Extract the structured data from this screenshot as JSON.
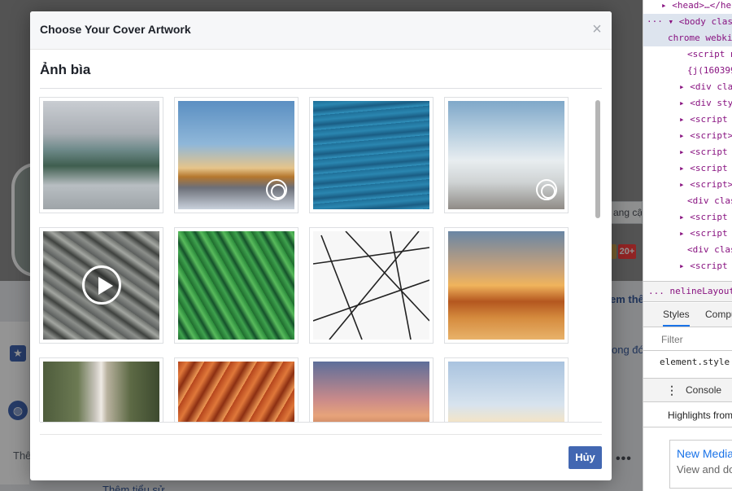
{
  "background_page": {
    "button_partial": "ang cậ",
    "badge": "20+",
    "link_partial_1": "em thê",
    "link_partial_2": "ong đó",
    "text_partial": "Thê",
    "link_bottom": "Thêm tiểu sử",
    "more_dots": "•••"
  },
  "devtools": {
    "lines": [
      {
        "text": "▸ <head>…</he",
        "indent": 22
      },
      {
        "text": "··· ▾ <body clas",
        "indent": 4
      },
      {
        "text": "chrome webki",
        "indent": 30
      },
      {
        "text": "<script n",
        "indent": 54
      },
      {
        "text": "{j(160399",
        "indent": 54
      },
      {
        "text": "▸ <div clas",
        "indent": 44
      },
      {
        "text": "▸ <div styl",
        "indent": 44
      },
      {
        "text": "▸ <script t",
        "indent": 44
      },
      {
        "text": "▸ <script>…",
        "indent": 44
      },
      {
        "text": "▸ <script n",
        "indent": 44
      },
      {
        "text": "▸ <script n",
        "indent": 44
      },
      {
        "text": "▸ <script>…",
        "indent": 44
      },
      {
        "text": "<div clas",
        "indent": 54
      },
      {
        "text": "▸ <script n",
        "indent": 44
      },
      {
        "text": "▸ <script n",
        "indent": 44
      },
      {
        "text": "<div clas",
        "indent": 54
      },
      {
        "text": "▸ <script n",
        "indent": 44
      }
    ],
    "breadcrumb": "... nelineLayout",
    "tabs": [
      "Styles",
      "Compu"
    ],
    "filter_placeholder": "Filter",
    "element_style": "element.style",
    "console_tab": "Console",
    "highlights": "Highlights from",
    "card_title": "New Media",
    "card_subtitle": "View and do"
  },
  "modal": {
    "title": "Choose Your Cover Artwork",
    "close_glyph": "×",
    "section_title": "Ảnh bìa",
    "cancel_label": "Hủy",
    "accent_color": "#4267b2",
    "artworks": [
      {
        "name": "mountain-lake",
        "style": "img-mountains",
        "overlay": ""
      },
      {
        "name": "sunset-peak-360",
        "style": "img-sunset",
        "overlay": "pano"
      },
      {
        "name": "ocean-waves",
        "style": "img-ocean",
        "overlay": ""
      },
      {
        "name": "cloud-sky-360",
        "style": "img-clouds",
        "overlay": "pano"
      },
      {
        "name": "rocks-video",
        "style": "img-rocks",
        "overlay": "play"
      },
      {
        "name": "fern-leaves",
        "style": "img-fern",
        "overlay": ""
      },
      {
        "name": "abstract-lines",
        "style": "img-lines",
        "overlay": "lines"
      },
      {
        "name": "desert-sunset",
        "style": "img-desert",
        "overlay": ""
      },
      {
        "name": "waterfall",
        "style": "img-waterfall",
        "overlay": ""
      },
      {
        "name": "red-canyon",
        "style": "img-canyon",
        "overlay": ""
      },
      {
        "name": "dusk-cliffs",
        "style": "img-dusk",
        "overlay": ""
      },
      {
        "name": "mountain-range",
        "style": "img-range",
        "overlay": ""
      }
    ]
  }
}
